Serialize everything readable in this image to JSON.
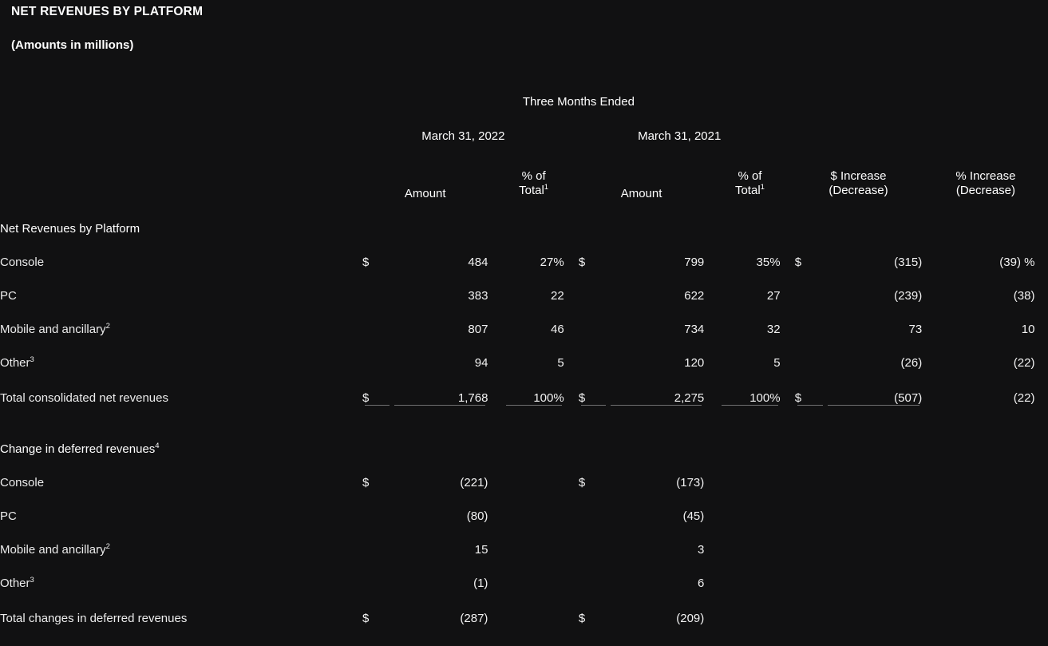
{
  "document": {
    "title": "NET REVENUES BY PLATFORM",
    "subtitle": "(Amounts in millions)"
  },
  "header": {
    "period_span": "Three Months Ended",
    "date_2022": "March 31, 2022",
    "date_2021": "March 31, 2021",
    "amount_label": "Amount",
    "pct_of_label": "% of",
    "pct_total_label": "Total",
    "pct_total_footnote": "1",
    "dollar_increase_line1": "$ Increase",
    "dollar_increase_line2": "(Decrease)",
    "pct_increase_line1": "% Increase",
    "pct_increase_line2": "(Decrease)"
  },
  "colors": {
    "background": "#111112",
    "text": "#f2f2f2",
    "rule": "#6f6f70"
  },
  "sections": [
    {
      "heading": "Net Revenues by Platform",
      "rows": [
        {
          "label": "Console",
          "footnote": "",
          "cur_2022": "$",
          "amount_2022": "484",
          "pct_2022": "27%",
          "cur_2021": "$",
          "amount_2021": "799",
          "pct_2021": "35%",
          "cur_inc": "$",
          "dollar_inc": "(315)",
          "pct_inc": "(39) %"
        },
        {
          "label": "PC",
          "footnote": "",
          "cur_2022": "",
          "amount_2022": "383",
          "pct_2022": "22",
          "cur_2021": "",
          "amount_2021": "622",
          "pct_2021": "27",
          "cur_inc": "",
          "dollar_inc": "(239)",
          "pct_inc": "(38)"
        },
        {
          "label": "Mobile and ancillary",
          "footnote": "2",
          "cur_2022": "",
          "amount_2022": "807",
          "pct_2022": "46",
          "cur_2021": "",
          "amount_2021": "734",
          "pct_2021": "32",
          "cur_inc": "",
          "dollar_inc": "73",
          "pct_inc": "10"
        },
        {
          "label": "Other",
          "footnote": "3",
          "cur_2022": "",
          "amount_2022": "94",
          "pct_2022": "5",
          "cur_2021": "",
          "amount_2021": "120",
          "pct_2021": "5",
          "cur_inc": "",
          "dollar_inc": "(26)",
          "pct_inc": "(22)"
        }
      ],
      "total": {
        "label": "Total consolidated net revenues",
        "cur_2022": "$",
        "amount_2022": "1,768",
        "pct_2022": "100%",
        "cur_2021": "$",
        "amount_2021": "2,275",
        "pct_2021": "100%",
        "cur_inc": "$",
        "dollar_inc": "(507)",
        "pct_inc": "(22)"
      }
    },
    {
      "heading": "Change in deferred revenues",
      "heading_footnote": "4",
      "rows": [
        {
          "label": "Console",
          "footnote": "",
          "cur_2022": "$",
          "amount_2022": "(221)",
          "pct_2022": "",
          "cur_2021": "$",
          "amount_2021": "(173)",
          "pct_2021": "",
          "cur_inc": "",
          "dollar_inc": "",
          "pct_inc": ""
        },
        {
          "label": "PC",
          "footnote": "",
          "cur_2022": "",
          "amount_2022": "(80)",
          "pct_2022": "",
          "cur_2021": "",
          "amount_2021": "(45)",
          "pct_2021": "",
          "cur_inc": "",
          "dollar_inc": "",
          "pct_inc": ""
        },
        {
          "label": "Mobile and ancillary",
          "footnote": "2",
          "cur_2022": "",
          "amount_2022": "15",
          "pct_2022": "",
          "cur_2021": "",
          "amount_2021": "3",
          "pct_2021": "",
          "cur_inc": "",
          "dollar_inc": "",
          "pct_inc": ""
        },
        {
          "label": "Other",
          "footnote": "3",
          "cur_2022": "",
          "amount_2022": "(1)",
          "pct_2022": "",
          "cur_2021": "",
          "amount_2021": "6",
          "pct_2021": "",
          "cur_inc": "",
          "dollar_inc": "",
          "pct_inc": ""
        }
      ],
      "total": {
        "label": "Total changes in deferred revenues",
        "cur_2022": "$",
        "amount_2022": "(287)",
        "pct_2022": "",
        "cur_2021": "$",
        "amount_2021": "(209)",
        "pct_2021": "",
        "cur_inc": "",
        "dollar_inc": "",
        "pct_inc": ""
      }
    }
  ]
}
